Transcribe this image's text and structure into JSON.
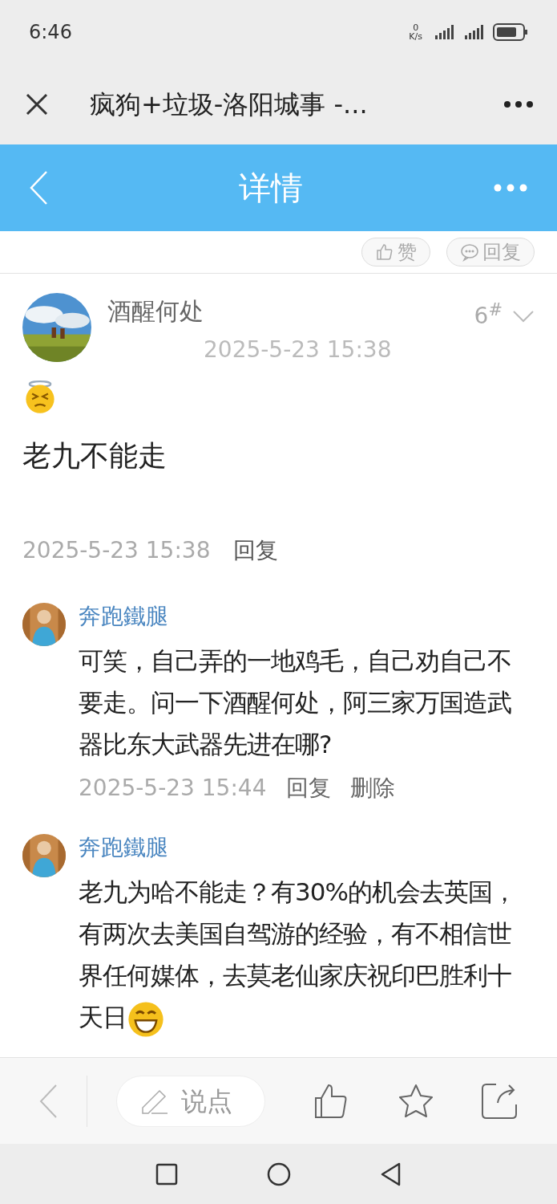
{
  "status_bar": {
    "time": "6:46",
    "net_speed_value": "0",
    "net_speed_unit": "K/s"
  },
  "browser_bar": {
    "title": "疯狗+垃圾-洛阳城事 -..."
  },
  "header": {
    "title": "详情"
  },
  "post_actions": [
    {
      "label": "赞",
      "kind": "like"
    },
    {
      "label": "回复",
      "kind": "reply"
    }
  ],
  "post": {
    "author": "酒醒何处",
    "floor": "6",
    "floor_mark": "#",
    "time": "2025-5-23 15:38",
    "emoji": {
      "kind": "annoyed"
    },
    "text": "老九不能走",
    "footer_time": "2025-5-23 15:38",
    "footer_actions": [
      "回复"
    ]
  },
  "replies": [
    {
      "author": "奔跑鐵腿",
      "text": "可笑，自己弄的一地鸡毛，自己劝自己不要走。问一下酒醒何处，阿三家万国造武器比东大武器先进在哪?",
      "time": "2025-5-23 15:44",
      "actions": [
        "回复",
        "删除"
      ]
    },
    {
      "author": "奔跑鐵腿",
      "text": "老九为哈不能走？有30%的机会去英国，有两次去美国自驾游的经验，有不相信世界任何媒体，去莫老仙家庆祝印巴胜利十天日",
      "emoji": {
        "kind": "grin"
      }
    }
  ],
  "toolbar": {
    "comment_placeholder": "说点"
  }
}
